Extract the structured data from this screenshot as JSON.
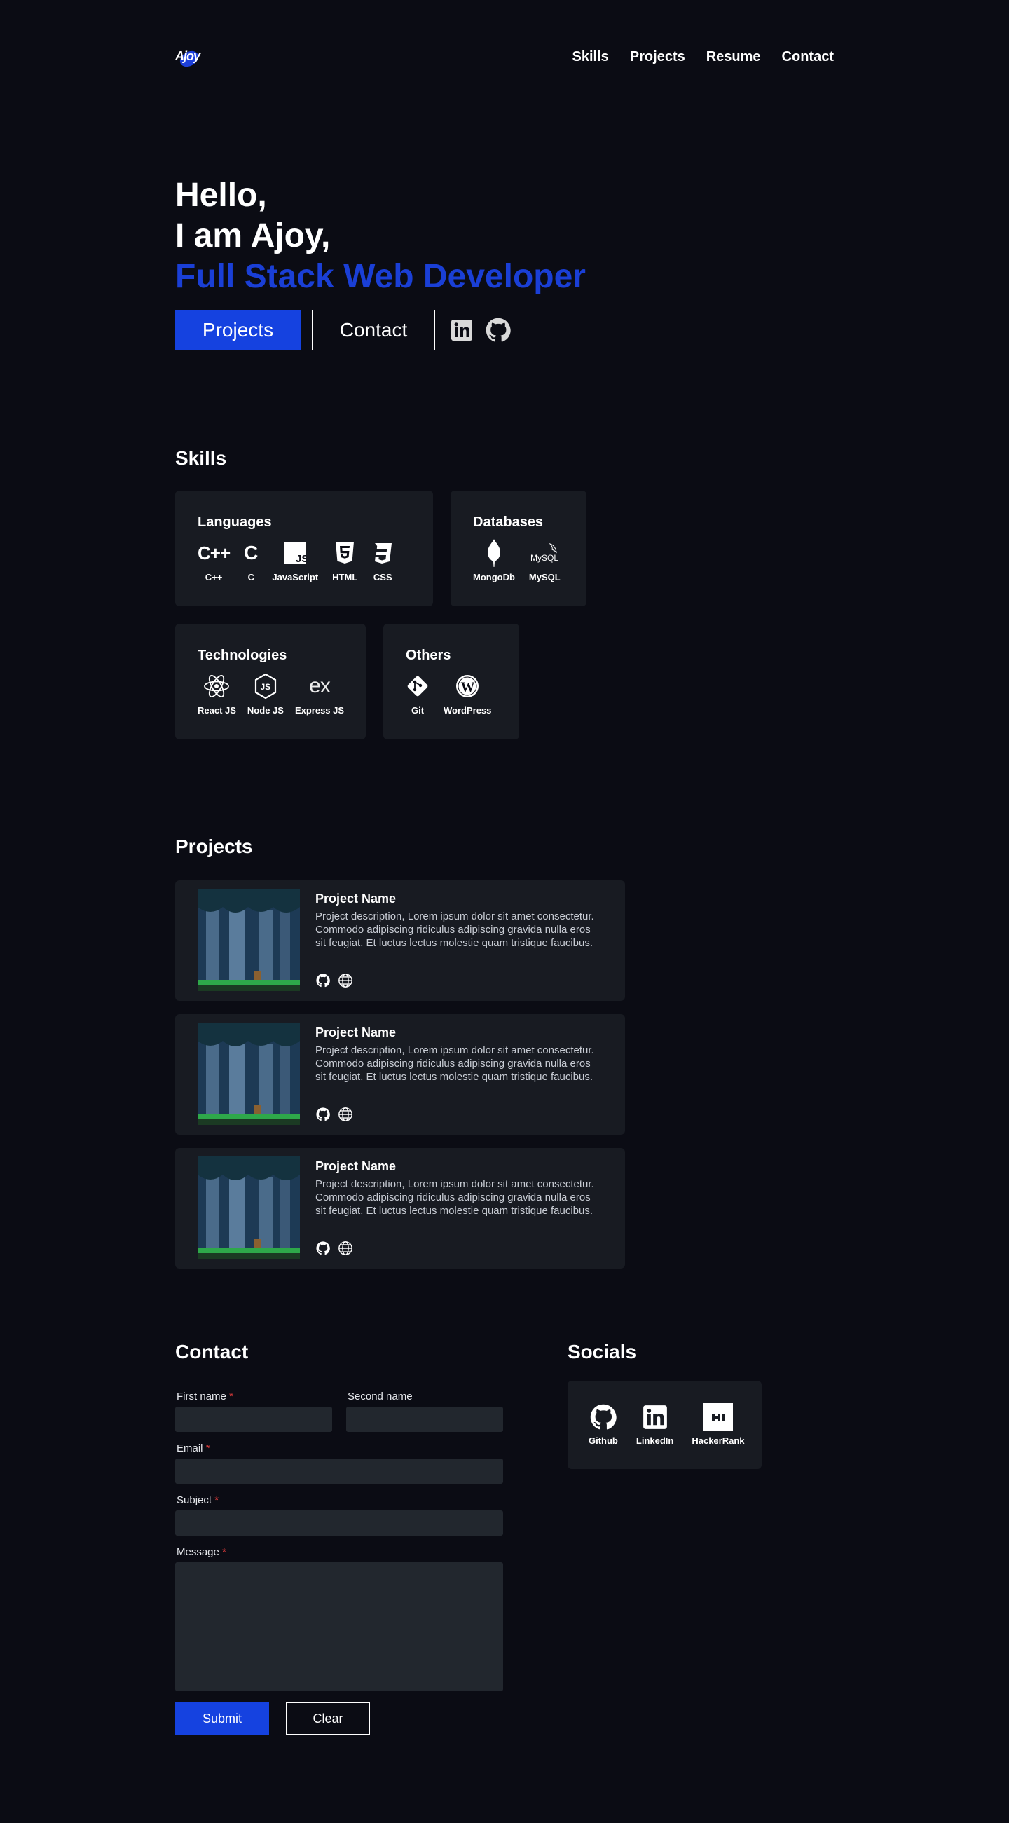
{
  "header": {
    "logo_text": "Ajoy",
    "nav": [
      "Skills",
      "Projects",
      "Resume",
      "Contact"
    ]
  },
  "hero": {
    "greeting": "Hello,",
    "intro": "I am Ajoy,",
    "role": "Full Stack Web Developer",
    "primary_button": "Projects",
    "secondary_button": "Contact",
    "social_icons": [
      "linkedin-icon",
      "github-icon"
    ]
  },
  "skills": {
    "title": "Skills",
    "categories": [
      {
        "title": "Languages",
        "items": [
          "C++",
          "C",
          "JavaScript",
          "HTML",
          "CSS"
        ]
      },
      {
        "title": "Databases",
        "items": [
          "MongoDb",
          "MySQL"
        ]
      },
      {
        "title": "Technologies",
        "items": [
          "React JS",
          "Node JS",
          "Express JS"
        ]
      },
      {
        "title": "Others",
        "items": [
          "Git",
          "WordPress"
        ]
      }
    ]
  },
  "projects": {
    "title": "Projects",
    "items": [
      {
        "name": "Project Name",
        "description": "Project description, Lorem ipsum dolor sit amet consectetur. Commodo adipiscing ridiculus adipiscing gravida nulla eros sit feugiat. Et luctus lectus molestie quam tristique faucibus."
      },
      {
        "name": "Project Name",
        "description": "Project description, Lorem ipsum dolor sit amet consectetur. Commodo adipiscing ridiculus adipiscing gravida nulla eros sit feugiat. Et luctus lectus molestie quam tristique faucibus."
      },
      {
        "name": "Project Name",
        "description": "Project description, Lorem ipsum dolor sit amet consectetur. Commodo adipiscing ridiculus adipiscing gravida nulla eros sit feugiat. Et luctus lectus molestie quam tristique faucibus."
      }
    ]
  },
  "contact": {
    "title": "Contact",
    "first_name_label": "First name",
    "second_name_label": "Second name",
    "email_label": "Email",
    "subject_label": "Subject",
    "message_label": "Message",
    "required_mark": "*",
    "submit_label": "Submit",
    "clear_label": "Clear"
  },
  "socials": {
    "title": "Socials",
    "items": [
      "Github",
      "LinkedIn",
      "HackerRank"
    ]
  },
  "colors": {
    "background": "#0b0c14",
    "card": "#181b22",
    "accent": "#1542e0",
    "input": "#22272e"
  }
}
